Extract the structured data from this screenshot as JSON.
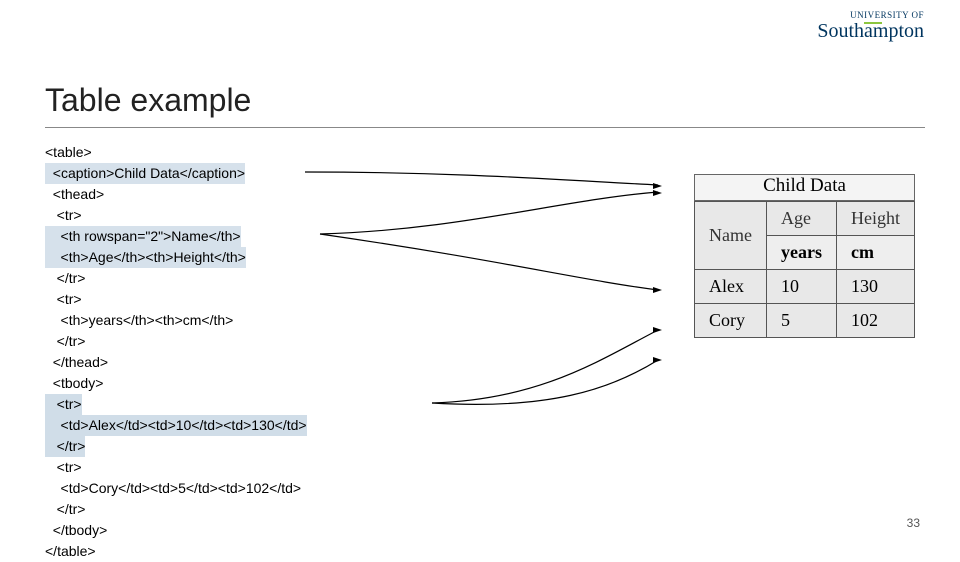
{
  "logo": {
    "top": "UNIVERSITY OF",
    "main": "Southampton"
  },
  "title": "Table example",
  "code": {
    "l1": "<table>",
    "l2a": "  <caption>Child Data</caption>",
    "l3": "  <thead>",
    "l4": "   <tr>",
    "l5a": "    <th rowspan=\"2\">Name</th>",
    "l6a": "    <th>Age</th><th>Height</th>",
    "l7": "   </tr>",
    "l8": "   <tr>",
    "l9": "    <th>years</th><th>cm</th>",
    "l10": "   </tr>",
    "l11": "  </thead>",
    "l12": "  <tbody>",
    "l13a": "   <tr>",
    "l14a": "    <td>Alex</td><td>10</td><td>130</td>",
    "l15a": "   </tr>",
    "l16": "   <tr>",
    "l17": "    <td>Cory</td><td>5</td><td>102</td>",
    "l18": "   </tr>",
    "l19": "  </tbody>",
    "l20": "</table>"
  },
  "table": {
    "caption": "Child Data",
    "headers": {
      "name": "Name",
      "age": "Age",
      "height": "Height"
    },
    "subheaders": {
      "age": "years",
      "height": "cm"
    },
    "rows": [
      {
        "name": "Alex",
        "age": "10",
        "height": "130"
      },
      {
        "name": "Cory",
        "age": "5",
        "height": "102"
      }
    ]
  },
  "page_number": "33"
}
